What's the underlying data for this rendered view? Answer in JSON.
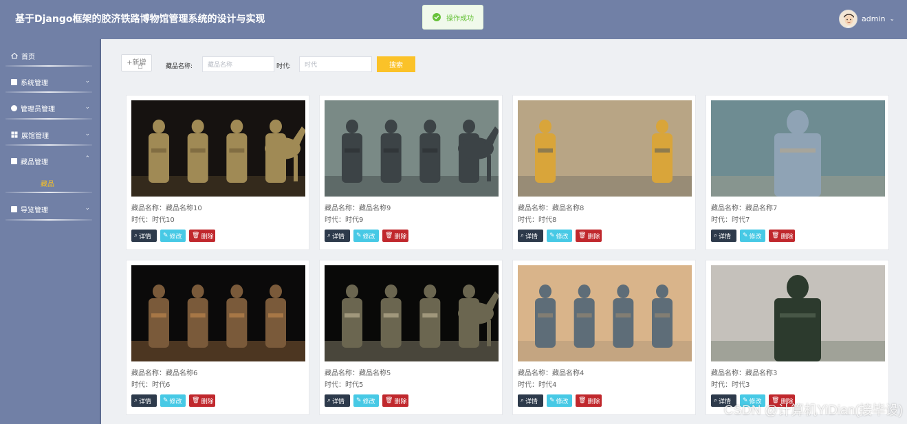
{
  "header": {
    "app_title": "基于Django框架的胶济铁路博物馆管理系统的设计与实现",
    "toast": "操作成功",
    "user_name": "admin"
  },
  "sidebar": {
    "items": [
      {
        "label": "首页",
        "icon": "home-icon"
      },
      {
        "label": "系统管理",
        "icon": "grid-icon"
      },
      {
        "label": "管理员管理",
        "icon": "user-icon"
      },
      {
        "label": "展馆管理",
        "icon": "apps-icon"
      },
      {
        "label": "藏品管理",
        "icon": "grid-icon"
      },
      {
        "label": "导览管理",
        "icon": "grid-icon"
      }
    ],
    "active_sub": "藏品"
  },
  "toolbar": {
    "add_label": "+新增",
    "name_label": "藏品名称:",
    "name_placeholder": "藏品名称",
    "era_label": "时代:",
    "era_placeholder": "时代",
    "search_label": "搜索"
  },
  "cards": [
    {
      "name": "藏品名称：藏品名称10",
      "era": "时代：时代10"
    },
    {
      "name": "藏品名称：藏品名称9",
      "era": "时代：时代9"
    },
    {
      "name": "藏品名称：藏品名称8",
      "era": "时代：时代8"
    },
    {
      "name": "藏品名称：藏品名称7",
      "era": "时代：时代7"
    },
    {
      "name": "藏品名称：藏品名称6",
      "era": "时代：时代6"
    },
    {
      "name": "藏品名称：藏品名称5",
      "era": "时代：时代5"
    },
    {
      "name": "藏品名称：藏品名称4",
      "era": "时代：时代4"
    },
    {
      "name": "藏品名称：藏品名称3",
      "era": "时代：时代3"
    }
  ],
  "actions": {
    "detail": "详情",
    "edit": "修改",
    "delete": "删除"
  },
  "watermark": "CSDN @计算机YiDian(接毕设)",
  "colors": {
    "header_bg": "#7180a6",
    "accent": "#fbc228",
    "detail": "#2d3a4b",
    "edit": "#47c9e5",
    "delete": "#c0282d"
  }
}
